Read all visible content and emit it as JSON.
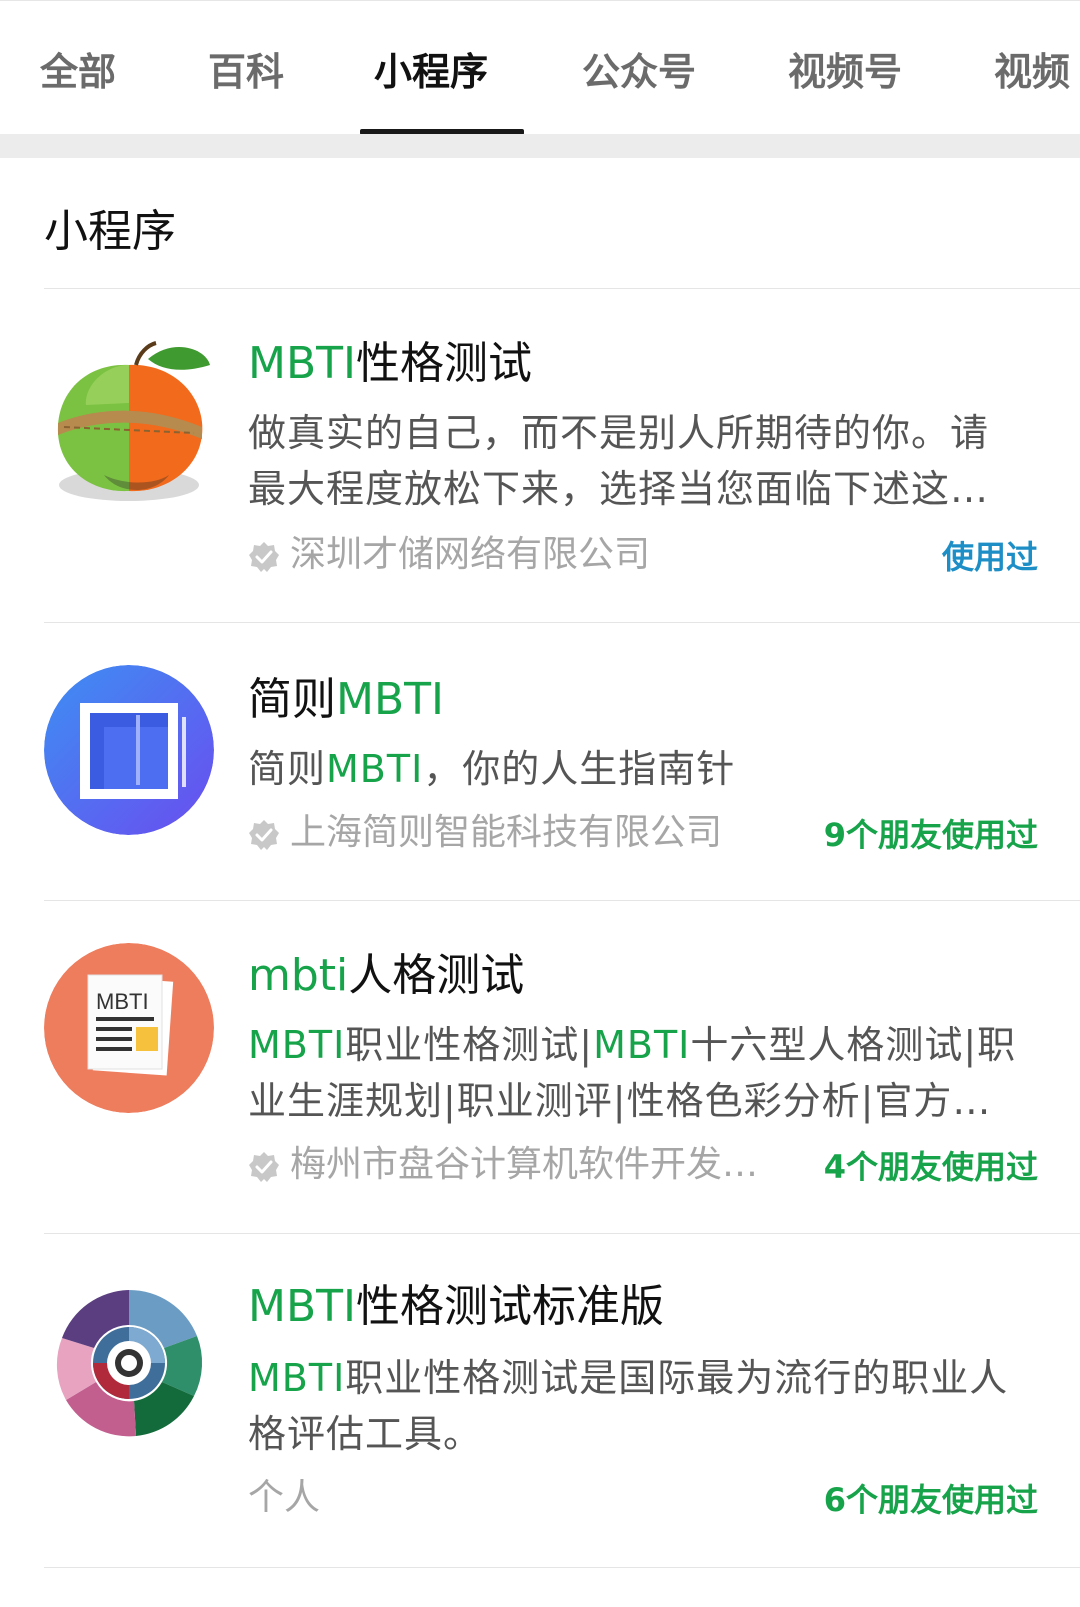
{
  "tabs": [
    {
      "label": "全部",
      "active": false
    },
    {
      "label": "百科",
      "active": false
    },
    {
      "label": "小程序",
      "active": true
    },
    {
      "label": "公众号",
      "active": false
    },
    {
      "label": "视频号",
      "active": false
    },
    {
      "label": "视频",
      "active": false
    }
  ],
  "section": {
    "title": "小程序"
  },
  "results": [
    {
      "icon": "apple-orange-rope-icon",
      "name_hl": "MBTI",
      "name_rest": "性格测试",
      "desc_line1": "做真实的自己，而不是别人所期待的你。请",
      "desc_line2": "最大程度放松下来，选择当您面临下述这…",
      "company": "深圳才储网络有限公司",
      "verified": true,
      "used": "使用过",
      "used_color": "#1e8fc6"
    },
    {
      "icon": "blue-square-frame-icon",
      "name_pre": "简则",
      "name_hl": "MBTI",
      "desc_pre": "简则",
      "desc_hl": "MBTI",
      "desc_rest": "，你的人生指南针",
      "company": "上海简则智能科技有限公司",
      "verified": true,
      "used": "9个朋友使用过",
      "used_color": "#16a34a"
    },
    {
      "icon": "mbti-document-icon",
      "name_hl": "mbti",
      "name_rest": "人格测试",
      "desc_l1_hl1": "MBTI",
      "desc_l1_t1": "职业性格测试|",
      "desc_l1_hl2": "MBTI",
      "desc_l1_t2": "十六型人格测试|职",
      "desc_line2": "业生涯规划|职业测评|性格色彩分析|官方…",
      "company": "梅州市盘谷计算机软件开发…",
      "verified": true,
      "used": "4个朋友使用过",
      "used_color": "#16a34a"
    },
    {
      "icon": "colorful-ring-logo-icon",
      "name_hl": "MBTI",
      "name_rest": "性格测试标准版",
      "desc_l1_hl": "MBTI",
      "desc_l1_rest": "职业性格测试是国际最为流行的职业人",
      "desc_line2": "格评估工具。",
      "company": "个人",
      "verified": false,
      "used": "6个朋友使用过",
      "used_color": "#16a34a"
    }
  ],
  "colors": {
    "highlight": "#16a34a",
    "used_blue": "#1e8fc6",
    "text_secondary": "#555555",
    "text_muted": "#a6a6a6"
  }
}
